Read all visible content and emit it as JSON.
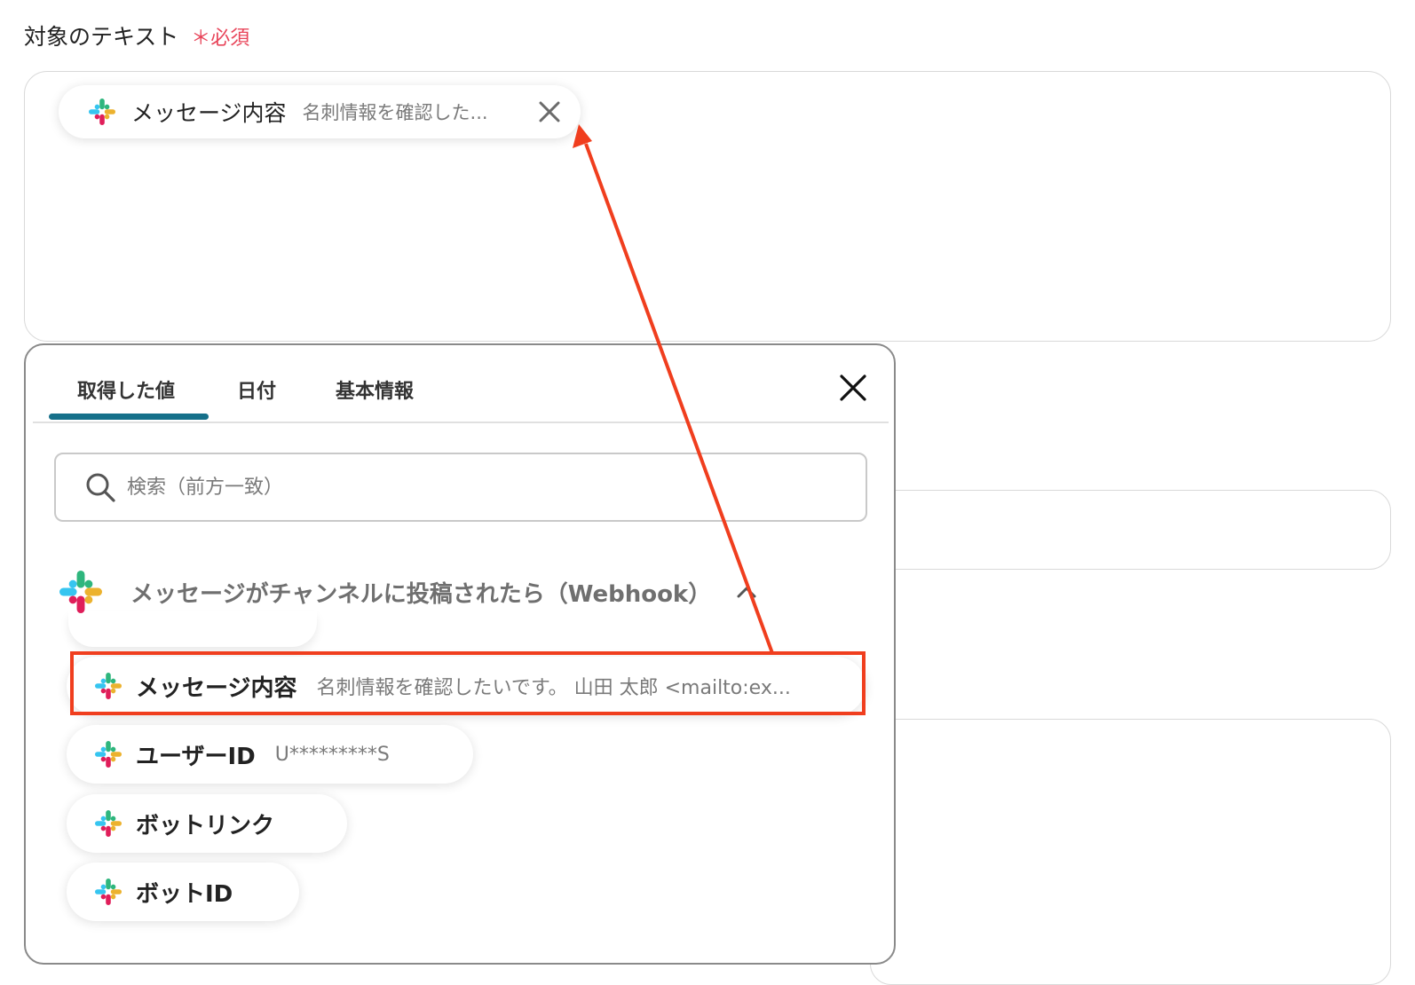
{
  "field": {
    "label": "対象のテキスト",
    "required_mark": "＊必須",
    "token": {
      "name": "メッセージ内容",
      "value": "名刺情報を確認した..."
    }
  },
  "popup": {
    "tabs": [
      {
        "label": "取得した値",
        "active": true
      },
      {
        "label": "日付",
        "active": false
      },
      {
        "label": "基本情報",
        "active": false
      }
    ],
    "search_placeholder": "検索（前方一致）",
    "group": {
      "title": "メッセージがチャンネルに投稿されたら（Webhook）",
      "expanded": true,
      "icon": "slack-icon"
    },
    "items": [
      {
        "name": "メッセージ内容",
        "value": "名刺情報を確認したいです。 山田 太郎 <mailto:ex...",
        "highlighted": true
      },
      {
        "name": "ユーザーID",
        "value": "U*********S",
        "highlighted": false
      },
      {
        "name": "ボットリンク",
        "value": "",
        "highlighted": false
      },
      {
        "name": "ボットID",
        "value": "",
        "highlighted": false
      }
    ]
  },
  "colors": {
    "required": "#e8455a",
    "tab_active": "#16708a",
    "annotation": "#f03e1e",
    "slack_blue": "#36c5f0",
    "slack_green": "#2eb67d",
    "slack_yellow": "#ecb22e",
    "slack_red": "#e01e5a"
  }
}
